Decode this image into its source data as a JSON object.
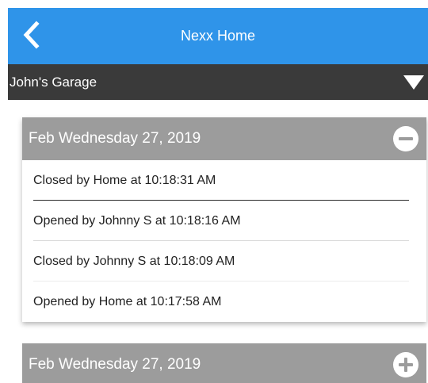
{
  "header": {
    "title": "Nexx Home",
    "back_icon": "chevron-left-icon",
    "background_color": "#2f94e9"
  },
  "location_bar": {
    "label": "John's Garage",
    "dropdown_icon": "triangle-down-icon",
    "background_color": "#3a3a3a"
  },
  "sections": [
    {
      "date": "Feb Wednesday 27, 2019",
      "expanded": true,
      "toggle_icon": "minus-circle-icon",
      "events": [
        "Closed by Home at 10:18:31 AM",
        "Opened by Johnny S at 10:18:16 AM",
        "Closed by Johnny S at 10:18:09 AM",
        "Opened by Home at 10:17:58 AM"
      ]
    },
    {
      "date": "Feb Wednesday 27, 2019",
      "expanded": false,
      "toggle_icon": "plus-circle-icon",
      "events": []
    }
  ],
  "colors": {
    "section_header": "#9c9c9c",
    "text_primary": "#222222"
  }
}
